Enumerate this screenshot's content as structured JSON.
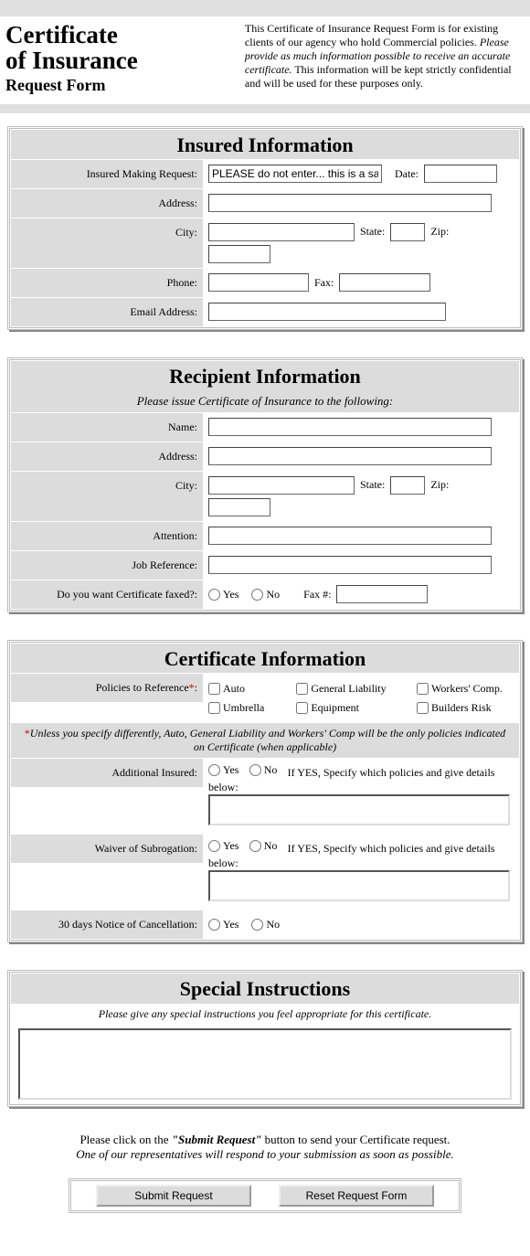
{
  "header": {
    "title_line1": "Certificate",
    "title_line2": "of Insurance",
    "title_line3": "Request Form",
    "desc_pre": "This Certificate of Insurance Request Form is for existing clients of our agency who hold Commercial policies. ",
    "desc_ital": "Please provide as much information possible to receive an accurate certificate.",
    "desc_post": " This information will be kept strictly confidential and will be used for these purposes only."
  },
  "insured": {
    "title": "Insured Information",
    "labels": {
      "requestor": "Insured Making Request:",
      "date": "Date:",
      "address": "Address:",
      "city": "City:",
      "state": "State:",
      "zip": "Zip:",
      "phone": "Phone:",
      "fax": "Fax:",
      "email": "Email Address:"
    },
    "requestor_value": "PLEASE do not enter... this is a sample"
  },
  "recipient": {
    "title": "Recipient Information",
    "subtitle": "Please issue Certificate of Insurance to the following:",
    "labels": {
      "name": "Name:",
      "address": "Address:",
      "city": "City:",
      "state": "State:",
      "zip": "Zip:",
      "attention": "Attention:",
      "job_ref": "Job Reference:",
      "want_fax": "Do you want Certificate faxed?:",
      "faxno": "Fax #:"
    },
    "yes": "Yes",
    "no": "No"
  },
  "certificate": {
    "title": "Certificate Information",
    "labels": {
      "policies": "Policies to Reference",
      "additional_insured": "Additional Insured:",
      "waiver": "Waiver of Subrogation:",
      "notice": "30 days Notice of Cancellation:"
    },
    "asterisk": "*",
    "policies_opts": {
      "auto": "Auto",
      "gl": "General Liability",
      "wc": "Workers' Comp.",
      "umbrella": "Umbrella",
      "equipment": "Equipment",
      "builders": "Builders Risk"
    },
    "note_text": "Unless you specify differently, Auto, General Liability and Workers' Comp will be the only policies indicated on Certificate (when applicable)",
    "yes": "Yes",
    "no": "No",
    "ifyes": "If YES, Specify which policies and give details below:"
  },
  "special": {
    "title": "Special Instructions",
    "subtitle": "Please give any special instructions you feel appropriate for this certificate."
  },
  "footer": {
    "line1_pre": "Please click on the ",
    "line1_bold": "\"Submit Request\"",
    "line1_post": " button to send your Certificate request.",
    "line2": "One of our representatives will respond to your submission as soon as possible.",
    "submit": "Submit Request",
    "reset": "Reset Request Form"
  }
}
